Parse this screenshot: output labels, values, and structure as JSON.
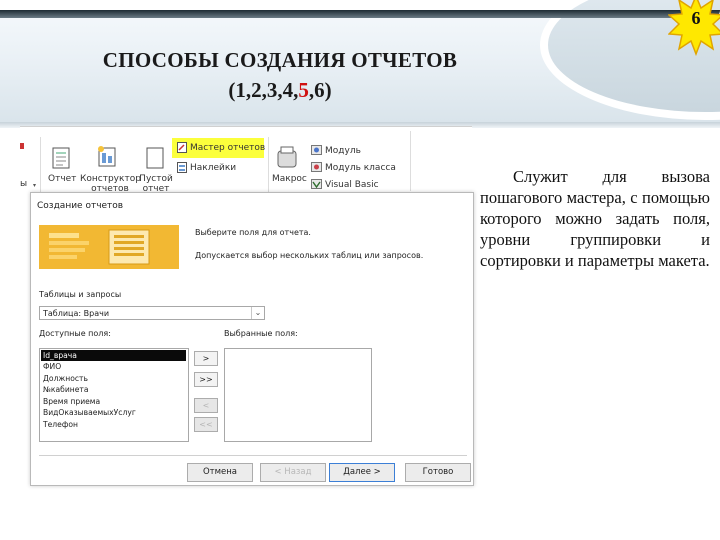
{
  "slide": {
    "title_line1": "СПОСОБЫ СОЗДАНИЯ ОТЧЕТОВ",
    "title_line2_prefix": "(1,2,3,4,",
    "title_line2_highlight": "5",
    "title_line2_suffix": ",6)",
    "page_number": "6",
    "description": "Служит для вызова пошагового мастера, с помощью которого можно задать поля, уровни группировки и сортировки и параметры макета.",
    "highlight_color": "#d01010"
  },
  "ribbon": {
    "report": "Отчет",
    "designer_line1": "Конструктор",
    "designer_line2": "отчетов",
    "blank_line1": "Пустой",
    "blank_line2": "отчет",
    "wizard": "Мастер отчетов",
    "labels": "Наклейки",
    "macro": "Макрос",
    "module": "Модуль",
    "class_module": "Модуль класса",
    "vba": "Visual Basic",
    "left_fragment": "ы"
  },
  "dialog": {
    "title": "Создание отчетов",
    "prompt": "Выберите поля для отчета.",
    "hint": "Допускается выбор нескольких таблиц или запросов.",
    "tables_label": "Таблицы и запросы",
    "table_value": "Таблица: Врачи",
    "available_label": "Доступные поля:",
    "selected_label": "Выбранные поля:",
    "available_fields": [
      "Id_врача",
      "ФИО",
      "Должность",
      "№кабинета",
      "Время приема",
      "ВидОказываемыхУслуг",
      "Телефон"
    ],
    "move_one": ">",
    "move_all": ">>",
    "remove_one": "<",
    "remove_all": "<<",
    "cancel": "Отмена",
    "back": "< Назад",
    "next": "Далее >",
    "finish": "Готово"
  }
}
